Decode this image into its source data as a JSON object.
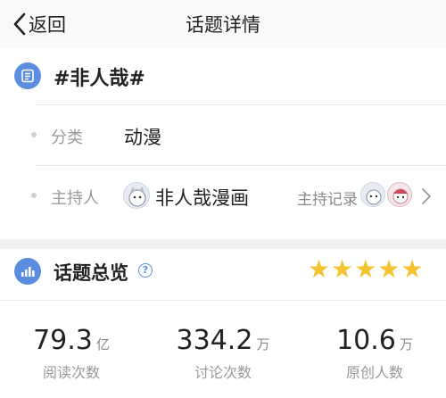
{
  "nav": {
    "back_label": "返回",
    "title": "话题详情"
  },
  "topic": {
    "name": "#非人哉#",
    "icon": "document-icon",
    "accent_color": "#5b8de0"
  },
  "category": {
    "label": "分类",
    "value": "动漫"
  },
  "host": {
    "label": "主持人",
    "name": "非人哉漫画",
    "record_label": "主持记录"
  },
  "overview": {
    "title": "话题总览",
    "icon": "bar-chart-icon",
    "help_icon": "question-icon",
    "rating": 5,
    "star_color": "#f4c332"
  },
  "stats": [
    {
      "value": "79.3",
      "unit": "亿",
      "label": "阅读次数"
    },
    {
      "value": "334.2",
      "unit": "万",
      "label": "讨论次数"
    },
    {
      "value": "10.6",
      "unit": "万",
      "label": "原创人数"
    }
  ]
}
